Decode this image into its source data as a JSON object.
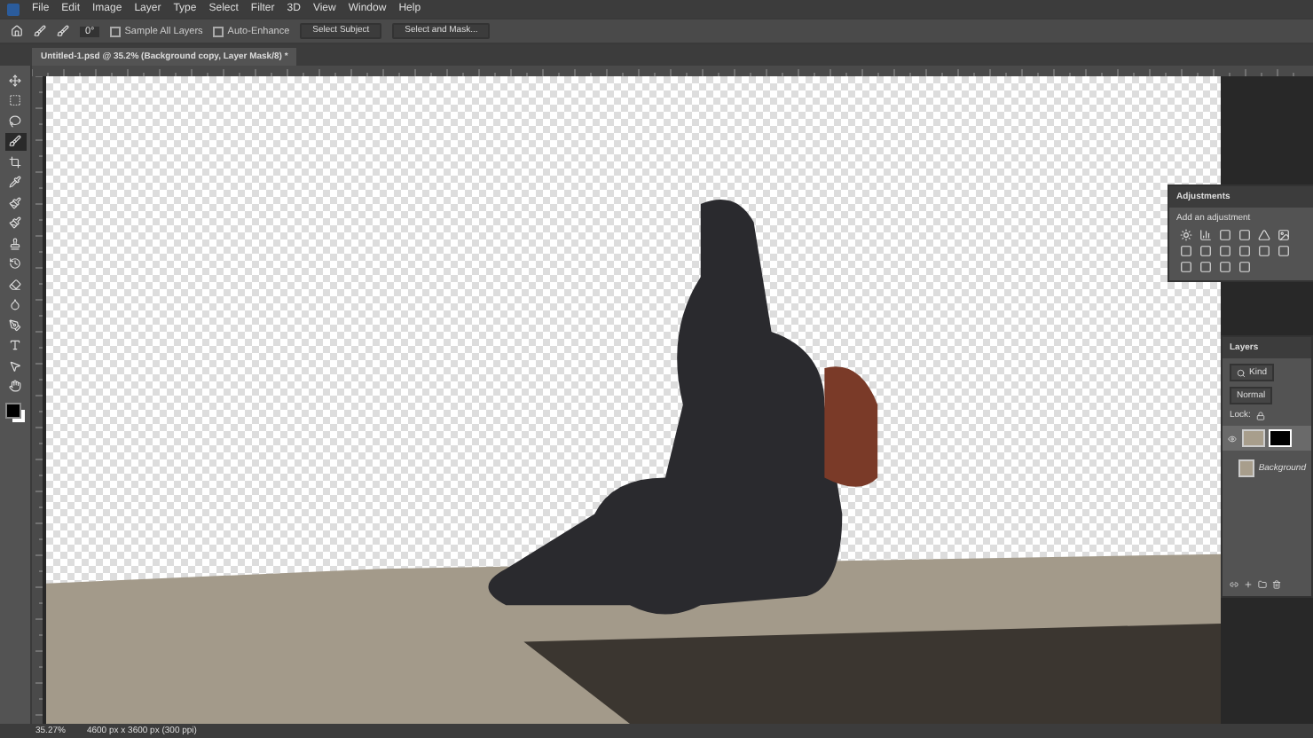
{
  "menu": [
    "File",
    "Edit",
    "Image",
    "Layer",
    "Type",
    "Select",
    "Filter",
    "3D",
    "View",
    "Window",
    "Help"
  ],
  "options": {
    "angle": "0°",
    "sample_all_layers": {
      "label": "Sample All Layers",
      "checked": false
    },
    "auto_enhance": {
      "label": "Auto-Enhance",
      "checked": false
    },
    "buttons": [
      "Select Subject",
      "Select and Mask..."
    ]
  },
  "document_tab": {
    "title": "Untitled-1.psd @ 35.2% (Background copy, Layer Mask/8) *",
    "selected": true
  },
  "tools": [
    {
      "selected": false
    },
    {
      "selected": false
    },
    {
      "selected": false
    },
    {
      "selected": true
    },
    {
      "selected": false
    },
    {
      "selected": false
    },
    {
      "selected": false
    },
    {
      "selected": false
    },
    {
      "selected": false
    },
    {
      "selected": false
    },
    {
      "selected": false
    },
    {
      "selected": false
    },
    {
      "selected": false
    },
    {
      "selected": false
    },
    {
      "selected": false
    },
    {
      "selected": false
    }
  ],
  "adjustments": {
    "title": "Adjustments",
    "hint": "Add an adjustment"
  },
  "layers": {
    "title": "Layers",
    "filter": "Kind",
    "blend_mode": "Normal",
    "lock_label": "Lock:",
    "items": [
      {
        "visible": true,
        "mask": true,
        "selected": true
      },
      {
        "name": "Background",
        "visible": false,
        "mask": false,
        "selected": false
      }
    ]
  },
  "status_bar": {
    "zoom": "35.27%",
    "size": "4600 px x 3600 px (300 ppi)"
  }
}
